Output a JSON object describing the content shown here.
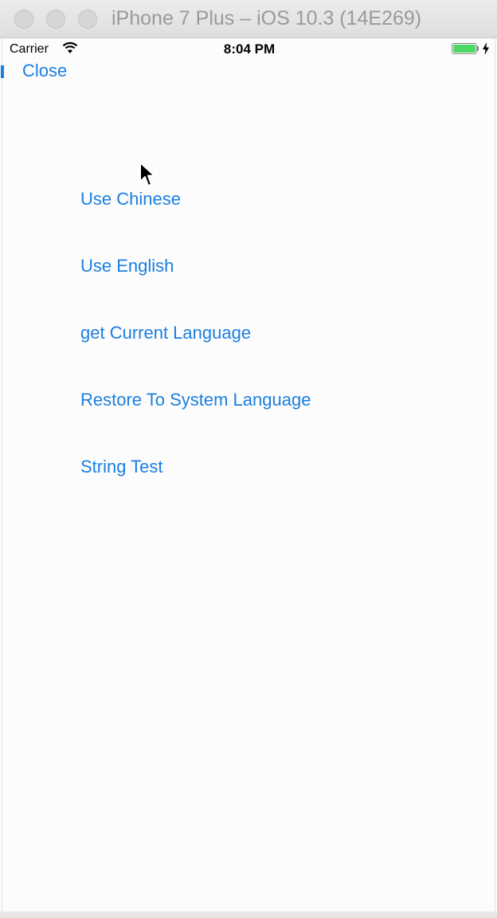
{
  "window": {
    "title": "iPhone 7 Plus – iOS 10.3 (14E269)"
  },
  "statusbar": {
    "carrier": "Carrier",
    "time": "8:04 PM",
    "battery_color": "#4cd964"
  },
  "nav": {
    "close_label": "Close"
  },
  "menu": {
    "items": [
      {
        "label": "Use Chinese"
      },
      {
        "label": "Use English"
      },
      {
        "label": "get Current Language"
      },
      {
        "label": "Restore To System Language"
      },
      {
        "label": "String Test"
      }
    ]
  },
  "colors": {
    "accent": "#1a7fe0"
  }
}
